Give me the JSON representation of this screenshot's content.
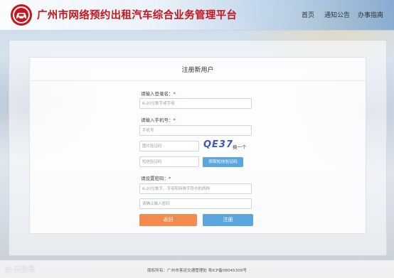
{
  "header": {
    "site_title": "广州市网络预约出租汽车综合业务管理平台",
    "nav": [
      "首页",
      "通知公告",
      "办事指南"
    ]
  },
  "form": {
    "title": "注册新用户",
    "username_label": "请输入登录名：",
    "username_placeholder": "6-20位数字或字母",
    "phone_label": "请输入手机号：",
    "phone_placeholder": "手机号",
    "image_code_placeholder": "图片验证码",
    "captcha_text": "QE37",
    "captcha_refresh": "换一个",
    "sms_code_placeholder": "短信验证码",
    "sms_button": "获取短信验证码",
    "password_label": "请设置密码：",
    "password_placeholder": "6-20位数字、字母和特殊字符中的两种",
    "confirm_placeholder": "请确认输入密码",
    "back_button": "返回",
    "register_button": "注册",
    "required_mark": "*"
  },
  "footer": {
    "copyright": "版权所有：广州市客运交通管理处   粤ICP备08045309号"
  },
  "watermark": "@ 大鱼号"
}
